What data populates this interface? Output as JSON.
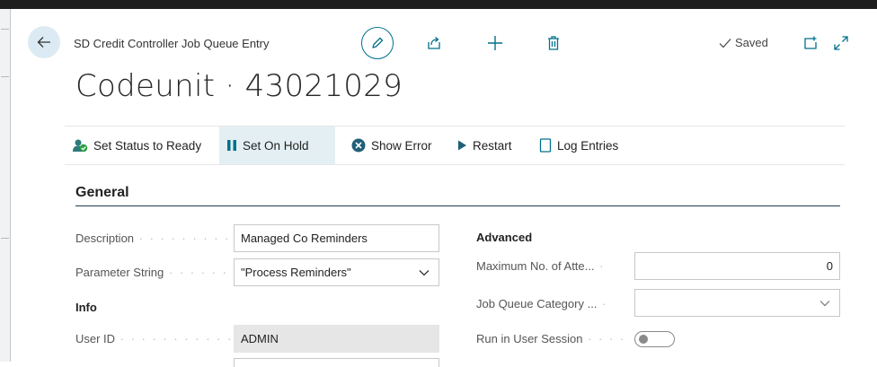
{
  "header": {
    "caption": "SD Credit Controller Job Queue Entry",
    "title": "Codeunit · 43021029",
    "saved_label": "Saved"
  },
  "actions": [
    {
      "label": "Set Status to Ready",
      "icon": "people-ready-icon"
    },
    {
      "label": "Set On Hold",
      "icon": "pause-icon"
    },
    {
      "label": "Show Error",
      "icon": "error-icon"
    },
    {
      "label": "Restart",
      "icon": "play-icon"
    },
    {
      "label": "Log Entries",
      "icon": "document-icon"
    }
  ],
  "section": {
    "title": "General"
  },
  "left": {
    "description_label": "Description",
    "description_value": "Managed Co Reminders",
    "parameter_label": "Parameter String",
    "parameter_value": "\"Process Reminders\"",
    "info_heading": "Info",
    "userid_label": "User ID",
    "userid_value": "ADMIN"
  },
  "right": {
    "advanced_heading": "Advanced",
    "max_attempts_label": "Maximum No. of Atte...",
    "max_attempts_value": "0",
    "category_label": "Job Queue Category ...",
    "category_value": "",
    "run_session_label": "Run in User Session",
    "run_session_value": false
  },
  "colors": {
    "accent": "#00718b",
    "active_action_bg": "#e3eff3",
    "section_rule": "#1f3c4d"
  }
}
